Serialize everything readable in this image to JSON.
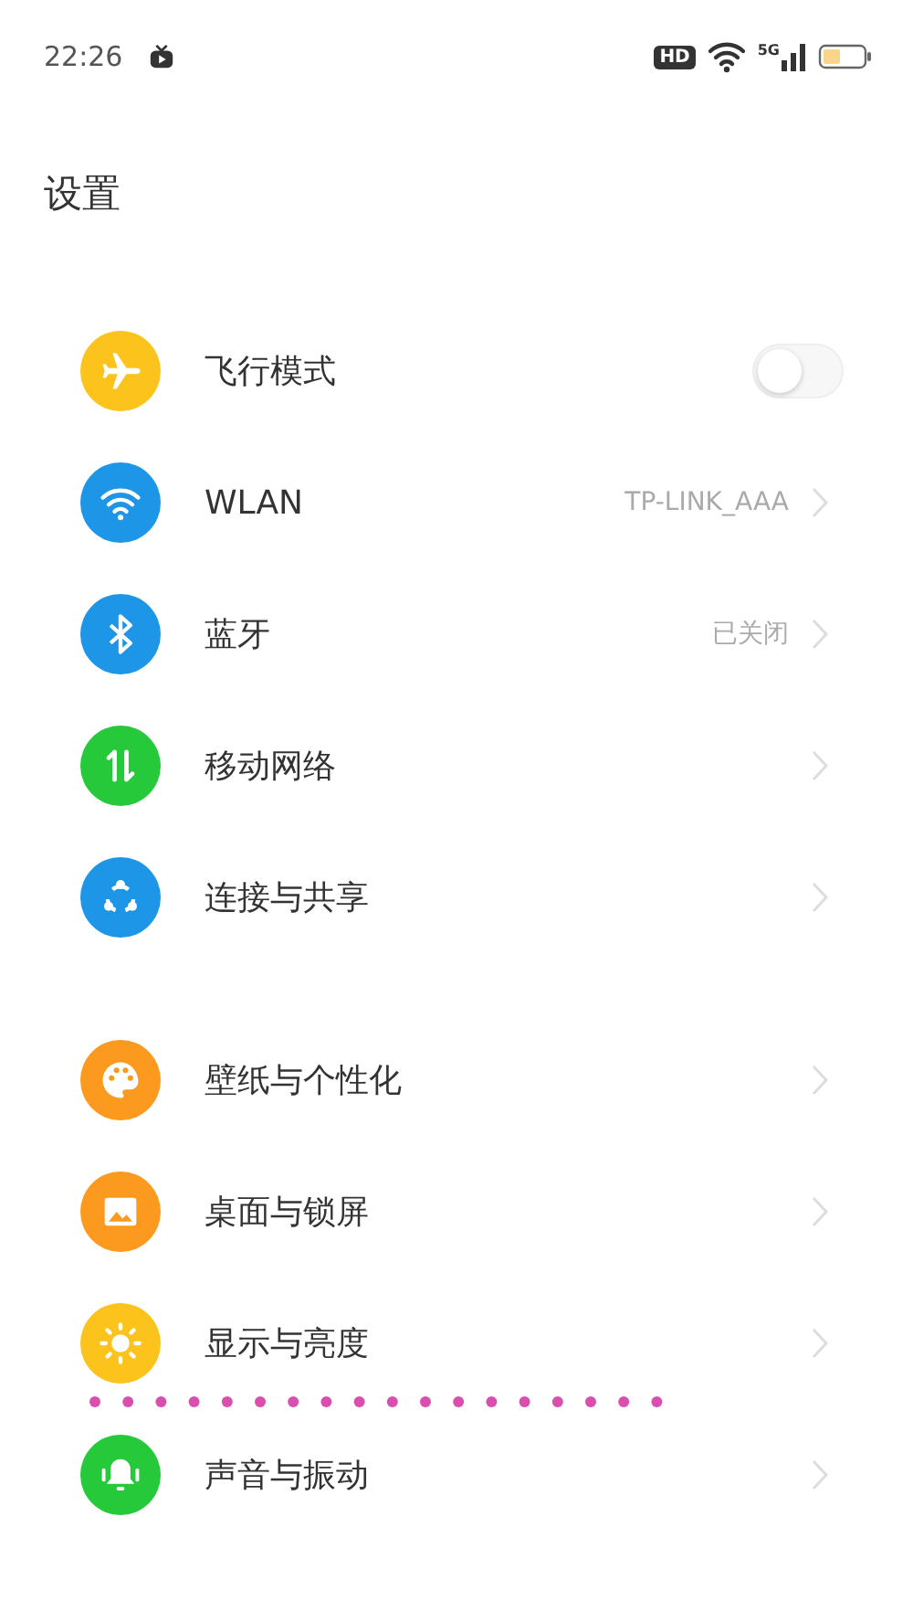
{
  "status_bar": {
    "time": "22:26",
    "hd_badge": "HD",
    "network": "5G"
  },
  "title": "设置",
  "groups": [
    {
      "items": [
        {
          "label": "飞行模式",
          "color": "#fbc31c",
          "kind": "toggle",
          "on": false
        },
        {
          "label": "WLAN",
          "color": "#1e96e8",
          "kind": "link",
          "value": "TP-LINK_AAA"
        },
        {
          "label": "蓝牙",
          "color": "#1e96e8",
          "kind": "link",
          "value": "已关闭"
        },
        {
          "label": "移动网络",
          "color": "#25c93a",
          "kind": "link"
        },
        {
          "label": "连接与共享",
          "color": "#1e96e8",
          "kind": "link"
        }
      ]
    },
    {
      "items": [
        {
          "label": "壁纸与个性化",
          "color": "#fb9a1f",
          "kind": "link"
        },
        {
          "label": "桌面与锁屏",
          "color": "#fb9a1f",
          "kind": "link"
        },
        {
          "label": "显示与亮度",
          "color": "#fbc31c",
          "kind": "link"
        }
      ]
    },
    {
      "items": [
        {
          "label": "声音与振动",
          "color": "#25c93a",
          "kind": "link"
        }
      ]
    }
  ]
}
